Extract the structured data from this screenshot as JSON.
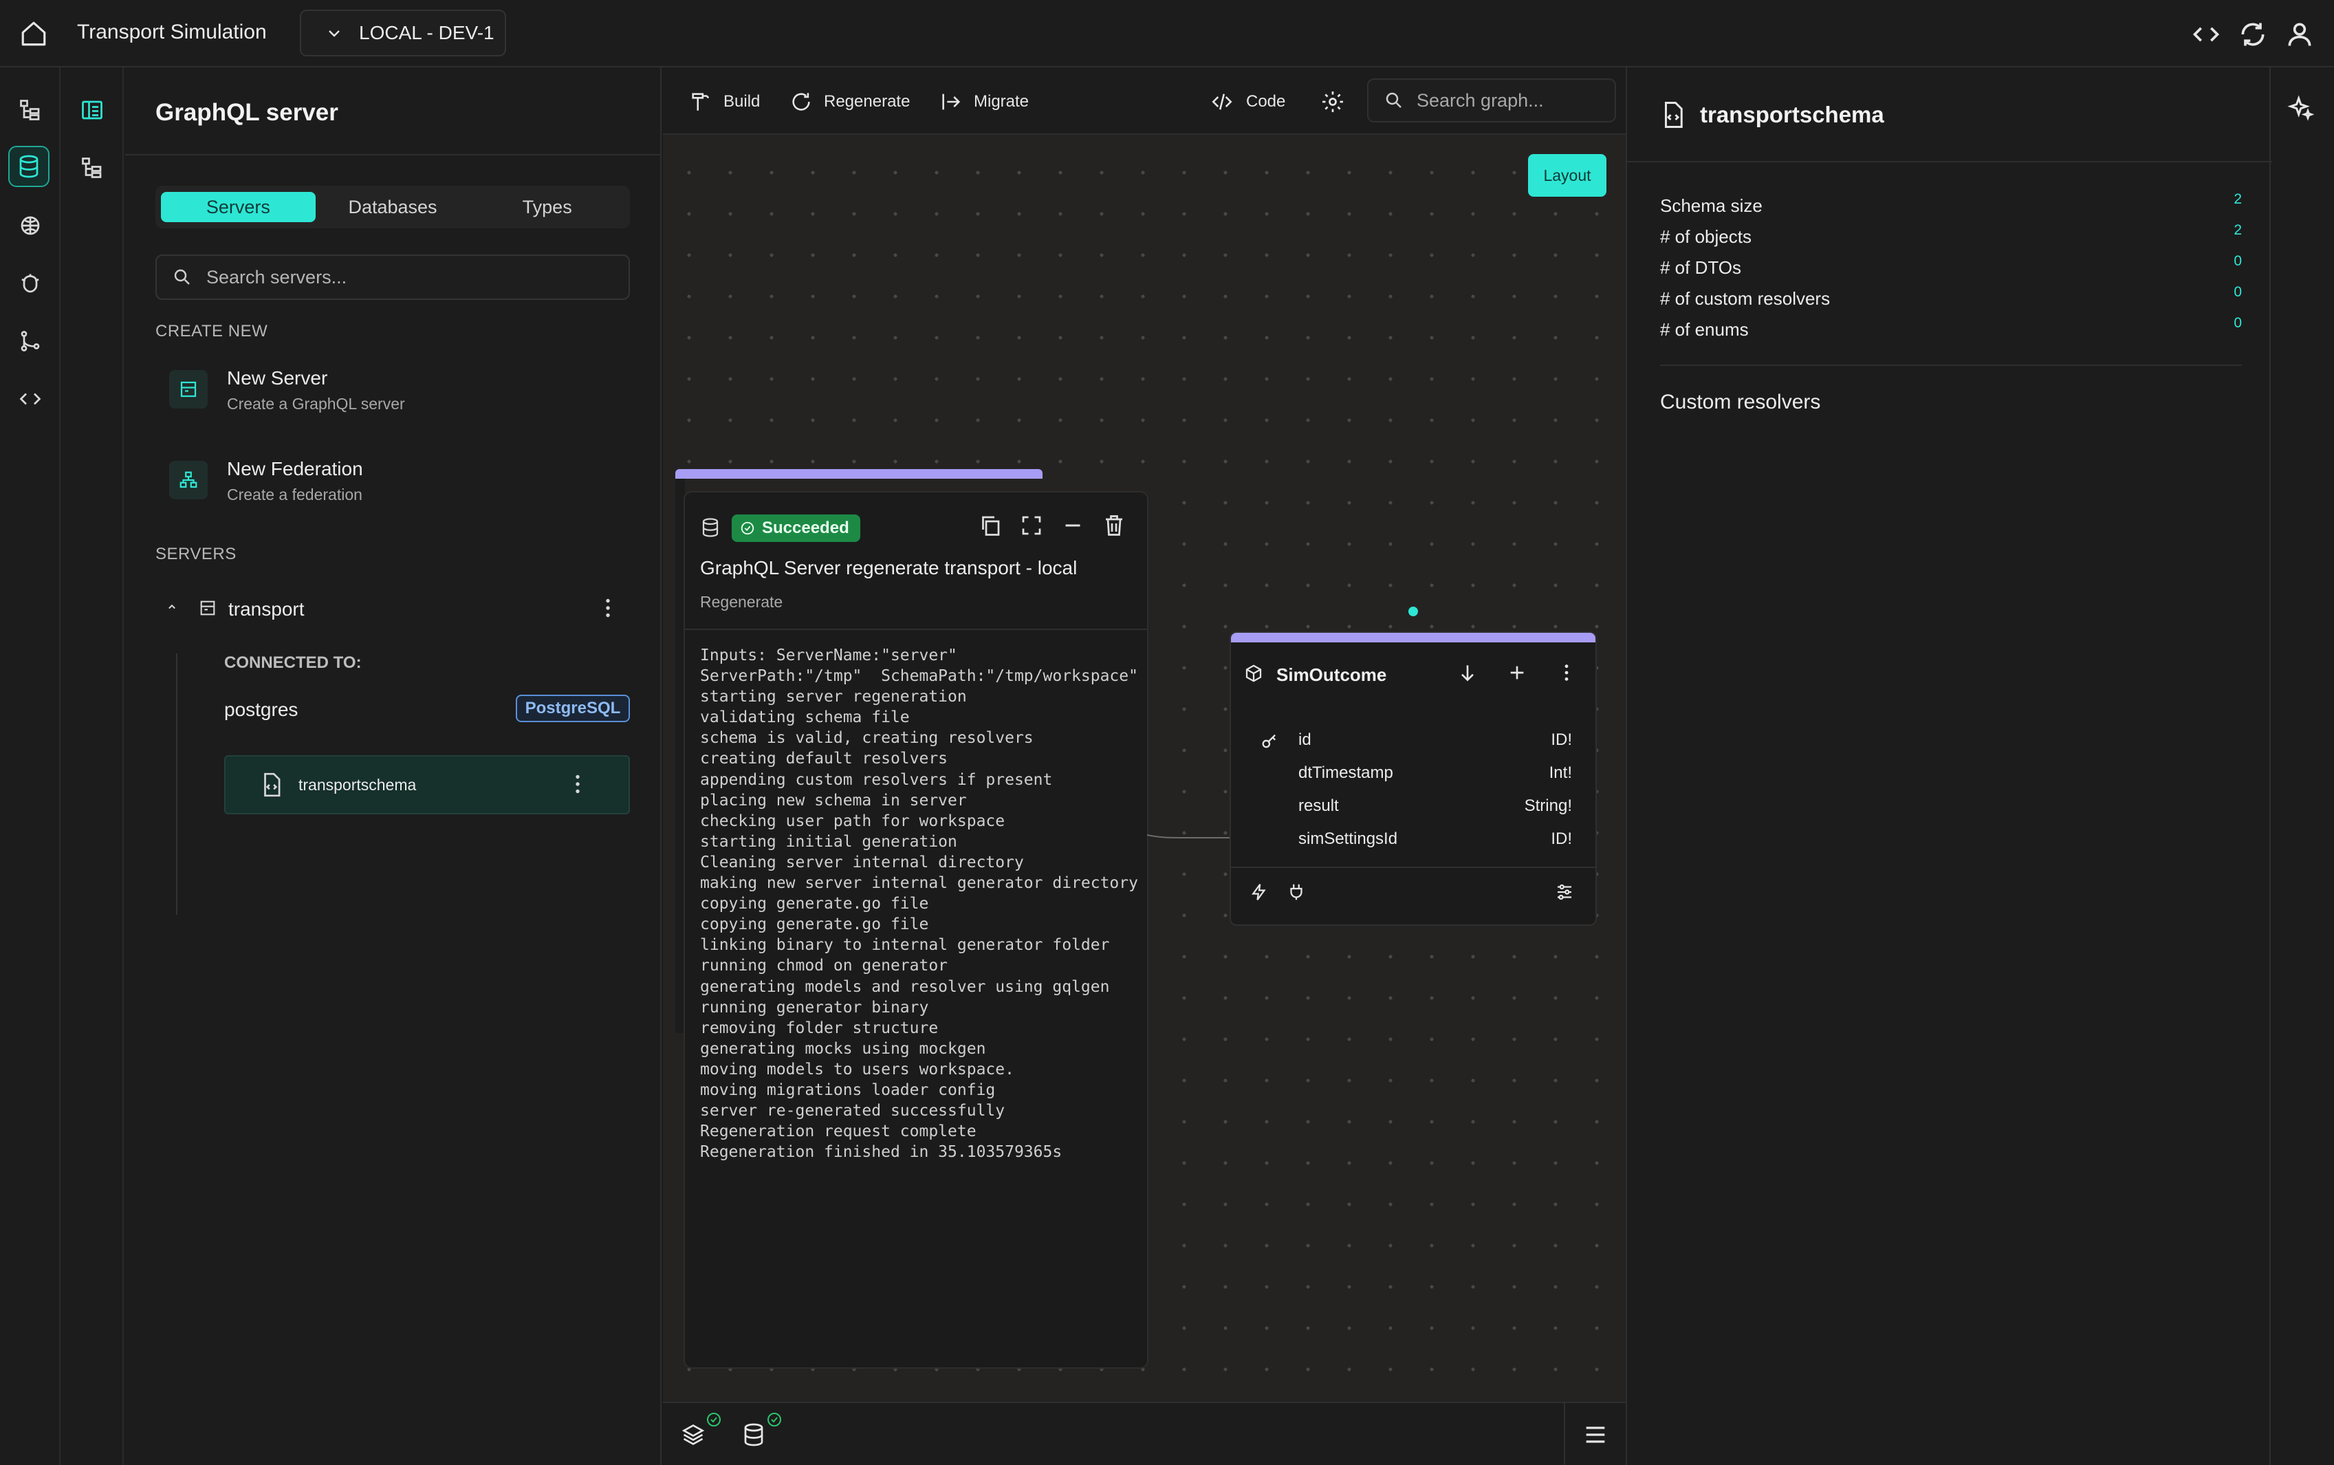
{
  "topbar": {
    "title": "Transport Simulation",
    "environment": "LOCAL - DEV-1"
  },
  "left_panel": {
    "title": "GraphQL server",
    "tabs": [
      {
        "label": "Servers",
        "active": true
      },
      {
        "label": "Databases",
        "active": false
      },
      {
        "label": "Types",
        "active": false
      }
    ],
    "search_placeholder": "Search servers...",
    "create_new_label": "CREATE NEW",
    "create_items": [
      {
        "title": "New Server",
        "subtitle": "Create a GraphQL server"
      },
      {
        "title": "New Federation",
        "subtitle": "Create a federation"
      }
    ],
    "servers_label": "SERVERS",
    "server": {
      "name": "transport",
      "connected_label": "CONNECTED TO:",
      "database": "postgres",
      "database_badge": "PostgreSQL",
      "schema": "transportschema"
    }
  },
  "toolbar": {
    "build": "Build",
    "regenerate": "Regenerate",
    "migrate": "Migrate",
    "code": "Code",
    "search_placeholder": "Search graph..."
  },
  "canvas": {
    "layout_button": "Layout"
  },
  "log_card": {
    "status": "Succeeded",
    "title": "GraphQL Server regenerate transport - local",
    "subtitle": "Regenerate",
    "lines": [
      "Inputs: ServerName:\"server\"",
      "ServerPath:\"/tmp\"  SchemaPath:\"/tmp/workspace\"",
      "starting server regeneration",
      "validating schema file",
      "schema is valid, creating resolvers",
      "creating default resolvers",
      "appending custom resolvers if present",
      "placing new schema in server",
      "checking user path for workspace",
      "starting initial generation",
      "Cleaning server internal directory",
      "making new server internal generator directory",
      "copying generate.go file",
      "copying generate.go file",
      "linking binary to internal generator folder",
      "running chmod on generator",
      "generating models and resolver using gqlgen",
      "running generator binary",
      "removing folder structure",
      "generating mocks using mockgen",
      "moving models to users workspace.",
      "moving migrations loader config",
      "server re-generated successfully",
      "Regeneration request complete",
      "Regeneration finished in 35.103579365s"
    ]
  },
  "entity": {
    "name": "SimOutcome",
    "fields": [
      {
        "name": "id",
        "type": "ID!",
        "key": true
      },
      {
        "name": "dtTimestamp",
        "type": "Int!",
        "key": false
      },
      {
        "name": "result",
        "type": "String!",
        "key": false
      },
      {
        "name": "simSettingsId",
        "type": "ID!",
        "key": false
      }
    ]
  },
  "right_panel": {
    "title": "transportschema",
    "stats": [
      {
        "label": "Schema size",
        "value": "2"
      },
      {
        "label": "# of objects",
        "value": "2"
      },
      {
        "label": "# of DTOs",
        "value": "0"
      },
      {
        "label": "# of custom resolvers",
        "value": "0"
      },
      {
        "label": "# of enums",
        "value": "0"
      }
    ],
    "custom_resolvers_label": "Custom resolvers"
  },
  "colors": {
    "accent": "#2ee6d4",
    "success": "#1c8a45",
    "card_stripe": "#a79df5",
    "badge": "#8fbaf2"
  }
}
